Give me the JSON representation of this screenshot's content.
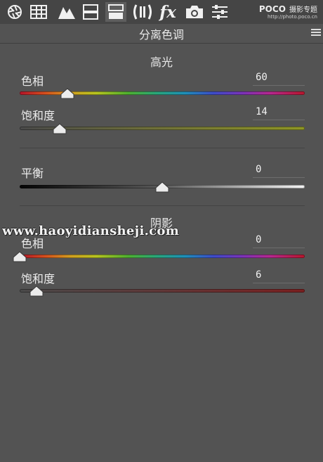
{
  "toolbar": {
    "icons": [
      "aperture-icon",
      "grid-icon",
      "tone-curve-icon",
      "hsl-icon",
      "split-toning-icon",
      "lens-correction-icon",
      "fx-icon",
      "camera-icon",
      "presets-sliders-icon"
    ],
    "fx_label": "fx",
    "active": "split-toning-icon"
  },
  "brand": {
    "logo": "POCO",
    "name": "摄影专题",
    "url": "http://photo.poco.cn"
  },
  "panel": {
    "title": "分离色调"
  },
  "highlights": {
    "title": "高光",
    "hue": {
      "label": "色相",
      "value": "60",
      "position": 60,
      "min": 0,
      "max": 360
    },
    "saturation": {
      "label": "饱和度",
      "value": "14",
      "position": 14,
      "min": 0,
      "max": 100
    }
  },
  "balance": {
    "label": "平衡",
    "value": "0",
    "position": 0,
    "min": -100,
    "max": 100
  },
  "shadows": {
    "title": "阴影",
    "hue": {
      "label": "色相",
      "value": "0",
      "position": 0,
      "min": 0,
      "max": 360
    },
    "saturation": {
      "label": "饱和度",
      "value": "6",
      "position": 6,
      "min": 0,
      "max": 100
    }
  },
  "watermark": "www.haoyidianshejі.com",
  "colors": {
    "panel_bg": "#535353",
    "toolbar_bg": "#454545",
    "text": "#e8e8e8"
  }
}
